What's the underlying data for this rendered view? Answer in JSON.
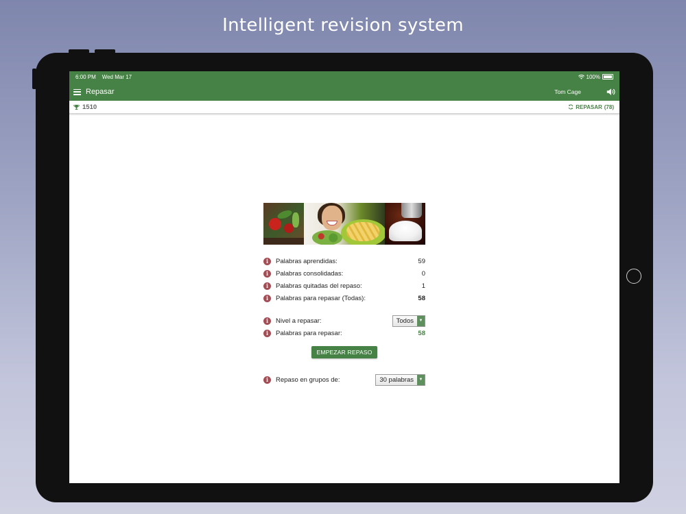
{
  "headline": "Intelligent revision system",
  "status_bar": {
    "time": "6:00 PM",
    "date": "Wed Mar 17",
    "battery": "100%"
  },
  "app_bar": {
    "title": "Repasar",
    "user": "Tom Cage",
    "menu_icon": "hamburger-menu-icon",
    "speaker_icon": "speaker-icon"
  },
  "sub_bar": {
    "score": "1510",
    "review_label": "REPASAR",
    "review_count": "(78)",
    "trophy_icon": "trophy-icon",
    "refresh_icon": "refresh-icon"
  },
  "stats": {
    "learned_label": "Palabras aprendidas:",
    "learned_value": "59",
    "consolidated_label": "Palabras consolidadas:",
    "consolidated_value": "0",
    "removed_label": "Palabras quitadas del repaso:",
    "removed_value": "1",
    "to_review_all_label": "Palabras para repasar (Todas):",
    "to_review_all_value": "58",
    "level_label": "Nivel a repasar:",
    "level_selected": "Todos",
    "to_review_label": "Palabras para repasar:",
    "to_review_value": "58",
    "groups_label": "Repaso en grupos de:",
    "groups_selected": "30 palabras"
  },
  "start_button": "EMPEZAR REPASO",
  "colors": {
    "app_green": "#468145",
    "info_icon": "#a34d55",
    "screen_bg": "#ffffff"
  }
}
